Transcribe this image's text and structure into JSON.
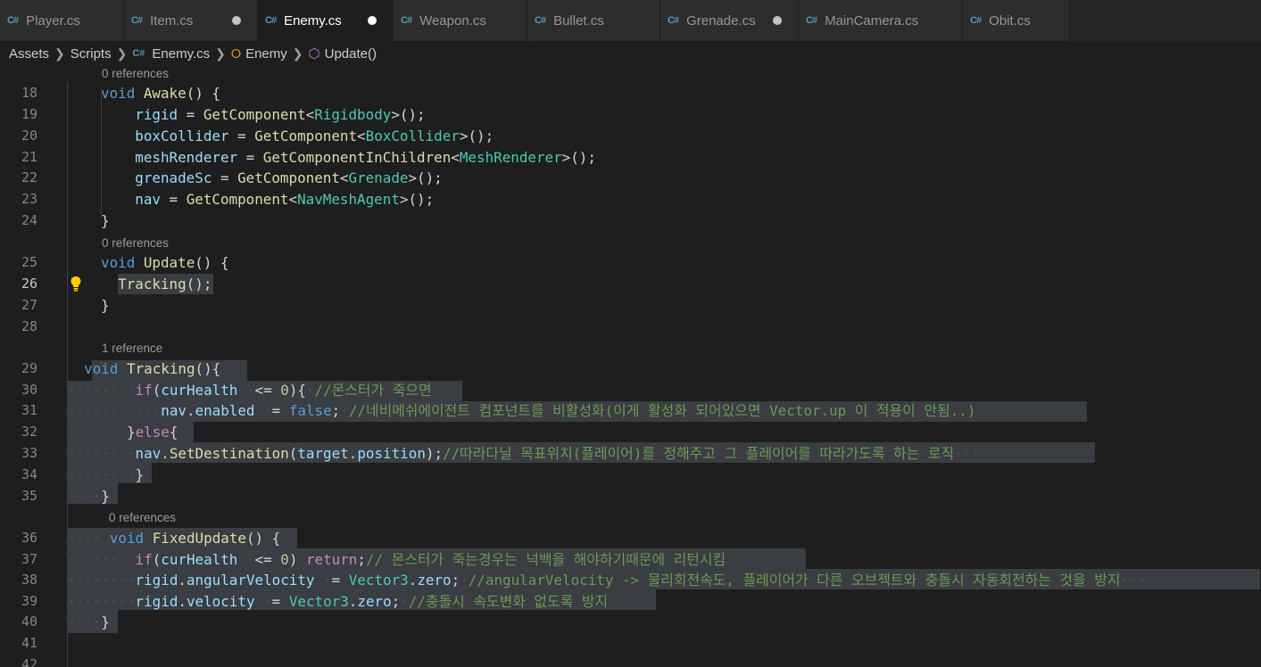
{
  "tabs": [
    {
      "label": "Player.cs",
      "active": false,
      "dirty": false
    },
    {
      "label": "Item.cs",
      "active": false,
      "dirty": true
    },
    {
      "label": "Enemy.cs",
      "active": true,
      "dirty": true
    },
    {
      "label": "Weapon.cs",
      "active": false,
      "dirty": false
    },
    {
      "label": "Bullet.cs",
      "active": false,
      "dirty": false
    },
    {
      "label": "Grenade.cs",
      "active": false,
      "dirty": true
    },
    {
      "label": "MainCamera.cs",
      "active": false,
      "dirty": false
    },
    {
      "label": "Obit.cs",
      "active": false,
      "dirty": false
    }
  ],
  "file_icon": "C#",
  "breadcrumb": {
    "folder1": "Assets",
    "folder2": "Scripts",
    "file": "Enemy.cs",
    "class": "Enemy",
    "method": "Update()"
  },
  "lenses": {
    "awake": "0 references",
    "update": "0 references",
    "tracking": "1 reference",
    "fixed": "0 references"
  },
  "lines": [
    {
      "n": "18",
      "html": "<span class=\"kw\">void</span> <span class=\"fn\">Awake</span>() {"
    },
    {
      "n": "19",
      "html": "    <span class=\"vr\">rigid</span> = <span class=\"fn\">GetComponent</span>&lt;<span class=\"ty\">Rigidbody</span>&gt;();"
    },
    {
      "n": "20",
      "html": "    <span class=\"vr\">boxCollider</span> = <span class=\"fn\">GetComponent</span>&lt;<span class=\"ty\">BoxCollider</span>&gt;();"
    },
    {
      "n": "21",
      "html": "    <span class=\"vr\">meshRenderer</span> = <span class=\"fn\">GetComponentInChildren</span>&lt;<span class=\"ty\">MeshRenderer</span>&gt;();"
    },
    {
      "n": "22",
      "html": "    <span class=\"vr\">grenadeSc</span> = <span class=\"fn\">GetComponent</span>&lt;<span class=\"ty\">Grenade</span>&gt;();"
    },
    {
      "n": "23",
      "html": "    <span class=\"vr\">nav</span> = <span class=\"fn\">GetComponent</span>&lt;<span class=\"ty\">NavMeshAgent</span>&gt;();"
    },
    {
      "n": "24",
      "html": "}"
    },
    {
      "n": "25",
      "html": "<span class=\"kw\">void</span> <span class=\"fn\">Update</span>() {"
    },
    {
      "n": "26",
      "html": "  <span class=\"fn\">Tracking</span>();"
    },
    {
      "n": "27",
      "html": "}"
    },
    {
      "n": "28",
      "html": ""
    },
    {
      "n": "29",
      "html": "  <span class=\"kw\">void</span> <span class=\"fn\">Tracking</span>(){"
    },
    {
      "n": "30",
      "html": "<span class=\"ws\">········</span><span class=\"ctl\">if</span>(<span class=\"vr\">curHealth</span> <span class=\"ws\">·</span>&lt;= <span class=\"num\">0</span>){<span class=\"ws\">·</span><span class=\"cm\">//몬스터가 죽으면</span>"
    },
    {
      "n": "31",
      "html": "<span class=\"ws\">···········</span><span class=\"vr\">nav</span>.<span class=\"vr\">enabled</span> <span class=\"ws\">·</span>= <span class=\"kw\">false</span>;<span class=\"ws\">·</span><span class=\"cm\">//네비메쉬에이전트 컴포넌트를 비활성화(이게 활성화 되어있으면 Vector.up 이 적용이 안됨..)</span>"
    },
    {
      "n": "32",
      "html": "<span class=\"ws\">·······</span>}<span class=\"ctl\">else</span>{"
    },
    {
      "n": "33",
      "html": "<span class=\"ws\">········</span><span class=\"vr\">nav</span>.<span class=\"fn\">SetDestination</span>(<span class=\"vr\">target</span>.<span class=\"vr\">position</span>);<span class=\"cm\">//따라다닐 목표위치(플레이어)를 정해주고 그 플레이어를 따라가도록 하는 로직</span><span class=\"ws\">···</span>"
    },
    {
      "n": "34",
      "html": "<span class=\"ws\">········</span>}"
    },
    {
      "n": "35",
      "html": "<span class=\"ws\">····</span>}"
    },
    {
      "n": "36",
      "html": "<span class=\"ws\">····</span> <span class=\"kw\">void</span> <span class=\"fn\">FixedUpdate</span>() {"
    },
    {
      "n": "37",
      "html": "<span class=\"ws\">········</span><span class=\"ctl\">if</span>(<span class=\"vr\">curHealth</span> <span class=\"ws\">·</span>&lt;= <span class=\"num\">0</span>) <span class=\"ctl\">return</span>;<span class=\"cm\">// 몬스터가 죽는경우는 넉백을 해야하기때문에 리턴시킴</span>"
    },
    {
      "n": "38",
      "html": "<span class=\"ws\">········</span><span class=\"vr\">rigid</span>.<span class=\"vr\">angularVelocity</span> <span class=\"ws\">·</span>= <span class=\"ty\">Vector3</span>.<span class=\"vr\">zero</span>;<span class=\"ws\">·</span><span class=\"cm\">//angularVelocity -&gt; 물리회전속도, 플레이어가 다른 오브젝트와 충돌시 자동회전하는 것을 방지</span><span class=\"ws\">···</span>"
    },
    {
      "n": "39",
      "html": "<span class=\"ws\">········</span><span class=\"vr\">rigid</span>.<span class=\"vr\">velocity</span> <span class=\"ws\">·</span>= <span class=\"ty\">Vector3</span>.<span class=\"vr\">zero</span>;<span class=\"ws\">·</span><span class=\"cm\">//충돌시 속도변화 없도록 방지</span>"
    },
    {
      "n": "40",
      "html": "<span class=\"ws\">····</span>}"
    },
    {
      "n": "41",
      "html": ""
    },
    {
      "n": "42",
      "html": ""
    }
  ]
}
